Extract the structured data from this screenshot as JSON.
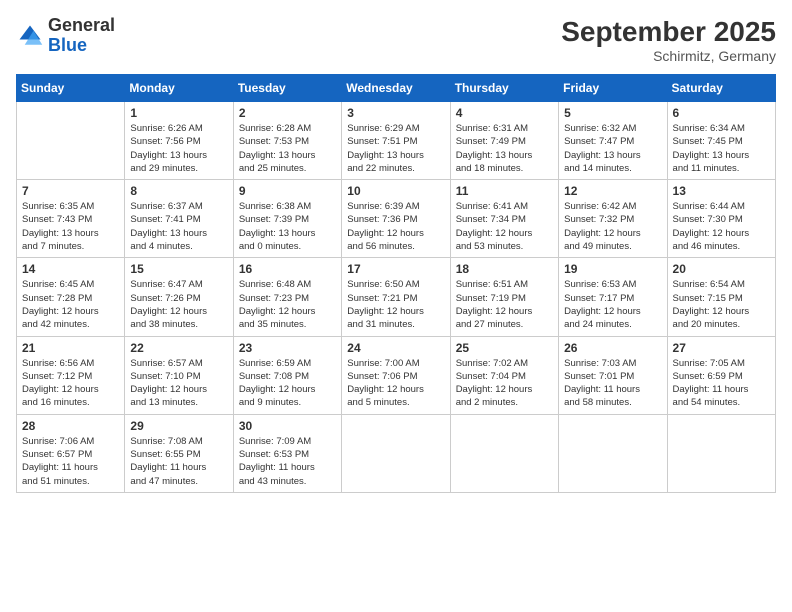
{
  "header": {
    "logo_general": "General",
    "logo_blue": "Blue",
    "month_year": "September 2025",
    "location": "Schirmitz, Germany"
  },
  "weekdays": [
    "Sunday",
    "Monday",
    "Tuesday",
    "Wednesday",
    "Thursday",
    "Friday",
    "Saturday"
  ],
  "weeks": [
    [
      {
        "day": "",
        "info": ""
      },
      {
        "day": "1",
        "info": "Sunrise: 6:26 AM\nSunset: 7:56 PM\nDaylight: 13 hours\nand 29 minutes."
      },
      {
        "day": "2",
        "info": "Sunrise: 6:28 AM\nSunset: 7:53 PM\nDaylight: 13 hours\nand 25 minutes."
      },
      {
        "day": "3",
        "info": "Sunrise: 6:29 AM\nSunset: 7:51 PM\nDaylight: 13 hours\nand 22 minutes."
      },
      {
        "day": "4",
        "info": "Sunrise: 6:31 AM\nSunset: 7:49 PM\nDaylight: 13 hours\nand 18 minutes."
      },
      {
        "day": "5",
        "info": "Sunrise: 6:32 AM\nSunset: 7:47 PM\nDaylight: 13 hours\nand 14 minutes."
      },
      {
        "day": "6",
        "info": "Sunrise: 6:34 AM\nSunset: 7:45 PM\nDaylight: 13 hours\nand 11 minutes."
      }
    ],
    [
      {
        "day": "7",
        "info": "Sunrise: 6:35 AM\nSunset: 7:43 PM\nDaylight: 13 hours\nand 7 minutes."
      },
      {
        "day": "8",
        "info": "Sunrise: 6:37 AM\nSunset: 7:41 PM\nDaylight: 13 hours\nand 4 minutes."
      },
      {
        "day": "9",
        "info": "Sunrise: 6:38 AM\nSunset: 7:39 PM\nDaylight: 13 hours\nand 0 minutes."
      },
      {
        "day": "10",
        "info": "Sunrise: 6:39 AM\nSunset: 7:36 PM\nDaylight: 12 hours\nand 56 minutes."
      },
      {
        "day": "11",
        "info": "Sunrise: 6:41 AM\nSunset: 7:34 PM\nDaylight: 12 hours\nand 53 minutes."
      },
      {
        "day": "12",
        "info": "Sunrise: 6:42 AM\nSunset: 7:32 PM\nDaylight: 12 hours\nand 49 minutes."
      },
      {
        "day": "13",
        "info": "Sunrise: 6:44 AM\nSunset: 7:30 PM\nDaylight: 12 hours\nand 46 minutes."
      }
    ],
    [
      {
        "day": "14",
        "info": "Sunrise: 6:45 AM\nSunset: 7:28 PM\nDaylight: 12 hours\nand 42 minutes."
      },
      {
        "day": "15",
        "info": "Sunrise: 6:47 AM\nSunset: 7:26 PM\nDaylight: 12 hours\nand 38 minutes."
      },
      {
        "day": "16",
        "info": "Sunrise: 6:48 AM\nSunset: 7:23 PM\nDaylight: 12 hours\nand 35 minutes."
      },
      {
        "day": "17",
        "info": "Sunrise: 6:50 AM\nSunset: 7:21 PM\nDaylight: 12 hours\nand 31 minutes."
      },
      {
        "day": "18",
        "info": "Sunrise: 6:51 AM\nSunset: 7:19 PM\nDaylight: 12 hours\nand 27 minutes."
      },
      {
        "day": "19",
        "info": "Sunrise: 6:53 AM\nSunset: 7:17 PM\nDaylight: 12 hours\nand 24 minutes."
      },
      {
        "day": "20",
        "info": "Sunrise: 6:54 AM\nSunset: 7:15 PM\nDaylight: 12 hours\nand 20 minutes."
      }
    ],
    [
      {
        "day": "21",
        "info": "Sunrise: 6:56 AM\nSunset: 7:12 PM\nDaylight: 12 hours\nand 16 minutes."
      },
      {
        "day": "22",
        "info": "Sunrise: 6:57 AM\nSunset: 7:10 PM\nDaylight: 12 hours\nand 13 minutes."
      },
      {
        "day": "23",
        "info": "Sunrise: 6:59 AM\nSunset: 7:08 PM\nDaylight: 12 hours\nand 9 minutes."
      },
      {
        "day": "24",
        "info": "Sunrise: 7:00 AM\nSunset: 7:06 PM\nDaylight: 12 hours\nand 5 minutes."
      },
      {
        "day": "25",
        "info": "Sunrise: 7:02 AM\nSunset: 7:04 PM\nDaylight: 12 hours\nand 2 minutes."
      },
      {
        "day": "26",
        "info": "Sunrise: 7:03 AM\nSunset: 7:01 PM\nDaylight: 11 hours\nand 58 minutes."
      },
      {
        "day": "27",
        "info": "Sunrise: 7:05 AM\nSunset: 6:59 PM\nDaylight: 11 hours\nand 54 minutes."
      }
    ],
    [
      {
        "day": "28",
        "info": "Sunrise: 7:06 AM\nSunset: 6:57 PM\nDaylight: 11 hours\nand 51 minutes."
      },
      {
        "day": "29",
        "info": "Sunrise: 7:08 AM\nSunset: 6:55 PM\nDaylight: 11 hours\nand 47 minutes."
      },
      {
        "day": "30",
        "info": "Sunrise: 7:09 AM\nSunset: 6:53 PM\nDaylight: 11 hours\nand 43 minutes."
      },
      {
        "day": "",
        "info": ""
      },
      {
        "day": "",
        "info": ""
      },
      {
        "day": "",
        "info": ""
      },
      {
        "day": "",
        "info": ""
      }
    ]
  ]
}
